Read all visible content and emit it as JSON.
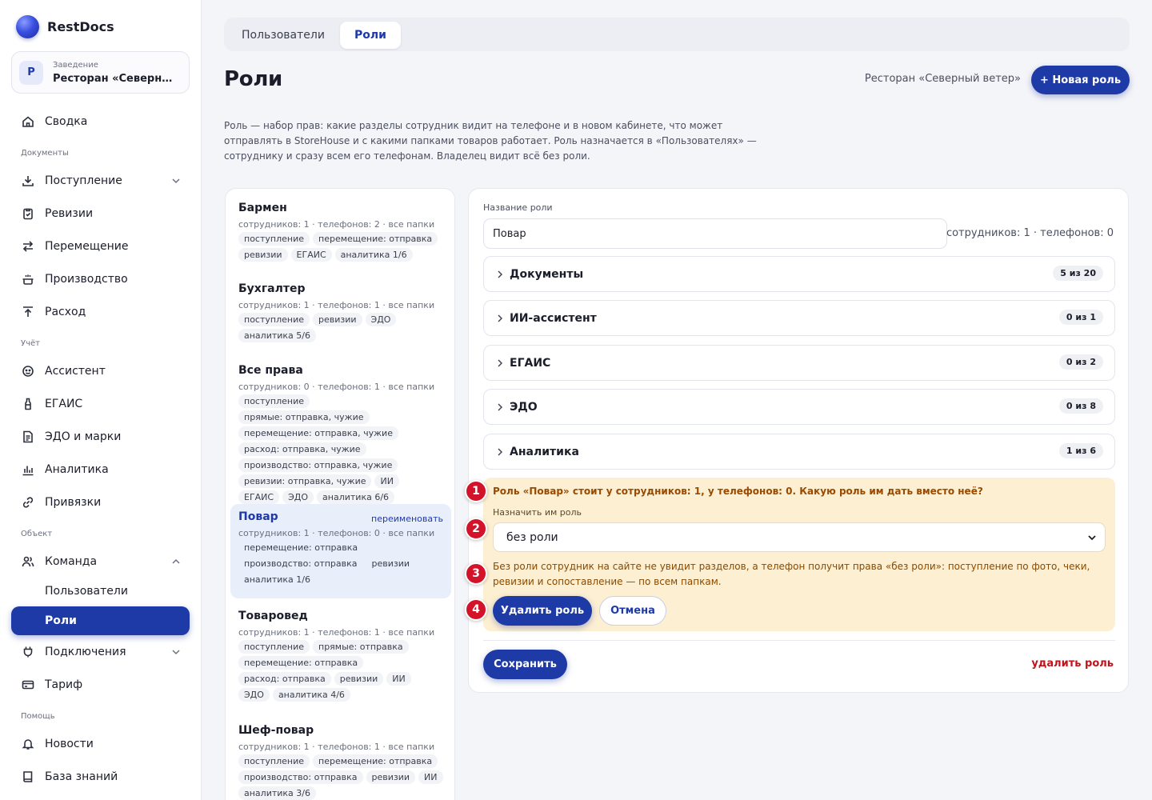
{
  "app": {
    "name": "RestDocs"
  },
  "colors": {
    "accent": "#1e3aa6",
    "danger": "#c0121a",
    "warning_bg": "#fdefd2",
    "marker": "#d3132a"
  },
  "venue": {
    "label": "Заведение",
    "badge": "Р",
    "name": "Ресторан «Северный ветер»"
  },
  "sidebar": {
    "summary": {
      "label": "Сводка",
      "icon": "home-icon"
    },
    "sections": {
      "documents": "Документы",
      "accounting": "Учёт",
      "object": "Объект",
      "help": "Помощь"
    },
    "items": {
      "incoming": {
        "label": "Поступление",
        "icon": "download-icon"
      },
      "revisions": {
        "label": "Ревизии",
        "icon": "clipboard-icon"
      },
      "transfer": {
        "label": "Перемещение",
        "icon": "swap-icon"
      },
      "production": {
        "label": "Производство",
        "icon": "pot-icon"
      },
      "expense": {
        "label": "Расход",
        "icon": "upload-icon"
      },
      "assistant": {
        "label": "Ассистент",
        "icon": "assistant-icon"
      },
      "egais": {
        "label": "ЕГАИС",
        "icon": "bottle-icon"
      },
      "edo": {
        "label": "ЭДО и марки",
        "icon": "document-icon"
      },
      "analytics": {
        "label": "Аналитика",
        "icon": "bar-chart-icon"
      },
      "bindings": {
        "label": "Привязки",
        "icon": "link-icon"
      },
      "team": {
        "label": "Команда",
        "icon": "users-icon"
      },
      "users": {
        "label": "Пользователи"
      },
      "roles": {
        "label": "Роли"
      },
      "connections": {
        "label": "Подключения",
        "icon": "plug-icon"
      },
      "tariff": {
        "label": "Тариф",
        "icon": "card-icon"
      },
      "news": {
        "label": "Новости",
        "icon": "bell-icon"
      },
      "kb": {
        "label": "База знаний",
        "icon": "book-icon"
      }
    }
  },
  "tabs": [
    {
      "label": "Пользователи",
      "active": false
    },
    {
      "label": "Роли",
      "active": true
    }
  ],
  "page": {
    "title": "Роли",
    "venue": "Ресторан «Северный ветер»",
    "new_role": "+ Новая роль",
    "description": "Роль — набор прав: какие разделы сотрудник видит на телефоне и в новом кабинете, что может отправлять в StoreHouse и с какими папками товаров работает. Роль назначается в «Пользователях» — сотруднику и сразу всем его телефонам. Владелец видит всё без роли."
  },
  "roles": [
    {
      "name": "Бармен",
      "meta": "сотрудников: 1 · телефонов: 2 · все папки",
      "chips": [
        "поступление",
        "перемещение: отправка",
        "ревизии",
        "ЕГАИС",
        "аналитика 1/6"
      ]
    },
    {
      "name": "Бухгалтер",
      "meta": "сотрудников: 1 · телефонов: 1 · все папки",
      "chips": [
        "поступление",
        "ревизии",
        "ЭДО",
        "аналитика 5/6"
      ]
    },
    {
      "name": "Все права",
      "meta": "сотрудников: 0 · телефонов: 1 · все папки",
      "chips": [
        "поступление",
        "прямые: отправка, чужие",
        "перемещение: отправка, чужие",
        "расход: отправка, чужие",
        "производство: отправка, чужие",
        "ревизии: отправка, чужие",
        "ИИ",
        "ЕГАИС",
        "ЭДО",
        "аналитика 6/6"
      ]
    },
    {
      "name": "Повар",
      "meta": "сотрудников: 1 · телефонов: 0 · все папки",
      "chips": [
        "перемещение: отправка",
        "производство: отправка",
        "ревизии",
        "аналитика 1/6"
      ],
      "active": true,
      "rename": "переименовать"
    },
    {
      "name": "Товаровед",
      "meta": "сотрудников: 1 · телефонов: 1 · все папки",
      "chips": [
        "поступление",
        "прямые: отправка",
        "перемещение: отправка",
        "расход: отправка",
        "ревизии",
        "ИИ",
        "ЭДО",
        "аналитика 4/6"
      ]
    },
    {
      "name": "Шеф-повар",
      "meta": "сотрудников: 1 · телефонов: 1 · все папки",
      "chips": [
        "поступление",
        "перемещение: отправка",
        "производство: отправка",
        "ревизии",
        "ИИ",
        "аналитика 3/6"
      ]
    }
  ],
  "editor": {
    "name_label": "Название роли",
    "name_value": "Повар",
    "stats": "сотрудников: 1 · телефонов: 0",
    "groups": [
      {
        "title": "Документы",
        "count": "5 из 20"
      },
      {
        "title": "ИИ-ассистент",
        "count": "0 из 1"
      },
      {
        "title": "ЕГАИС",
        "count": "0 из 2"
      },
      {
        "title": "ЭДО",
        "count": "0 из 8"
      },
      {
        "title": "Аналитика",
        "count": "1 из 6"
      }
    ],
    "warning": {
      "title": "Роль «Повар» стоит у сотрудников: 1, у телефонов: 0. Какую роль им дать вместо неё?",
      "assign_label": "Назначить им роль",
      "selected": "без роли",
      "note": "Без роли сотрудник на сайте не увидит разделов, а телефон получит права «без роли»: поступление по фото, чеки, ревизии и сопоставление — по всем папкам.",
      "delete": "Удалить роль",
      "cancel": "Отмена"
    },
    "save": "Сохранить",
    "delete_link": "удалить роль"
  },
  "markers": [
    "1",
    "2",
    "3",
    "4"
  ]
}
